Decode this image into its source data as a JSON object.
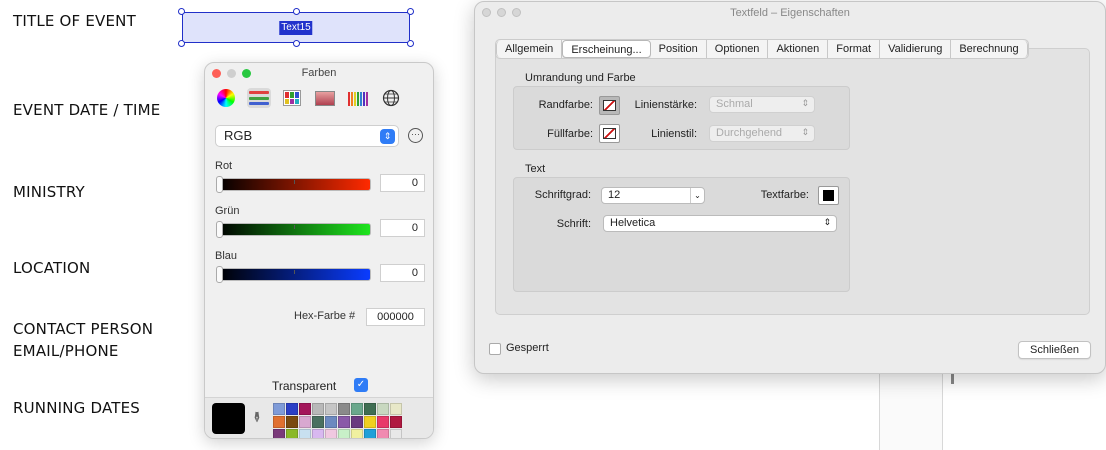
{
  "document": {
    "labels": [
      "TITLE OF EVENT",
      "EVENT DATE / TIME",
      "MINISTRY",
      "LOCATION",
      "CONTACT PERSON",
      "EMAIL/PHONE",
      "RUNNING DATES"
    ],
    "field_name": "Text15"
  },
  "colors_panel": {
    "title": "Farben",
    "mode_icons": [
      "color-wheel-icon",
      "sliders-icon",
      "palettes-icon",
      "image-palette-icon",
      "pencils-icon",
      "web-icon"
    ],
    "model": "RGB",
    "channels": [
      {
        "label": "Rot",
        "value": "0",
        "gradient_end": "#ff2a00"
      },
      {
        "label": "Grün",
        "value": "0",
        "gradient_end": "#1ee51e"
      },
      {
        "label": "Blau",
        "value": "0",
        "gradient_end": "#0a3cff"
      }
    ],
    "hex_label": "Hex-Farbe #",
    "hex_value": "000000",
    "transparent_label": "Transparent",
    "transparent_checked": true,
    "current_color": "#000000",
    "swatches": [
      "#7f9bd8",
      "#2b3fc6",
      "#a3165a",
      "#b8b8b8",
      "#c5c5c5",
      "#8a8a8a",
      "#6aa88c",
      "#3f6e52",
      "#c8d8c0",
      "#e8e8c8",
      "#e07030",
      "#7a4a10",
      "#d8a8d0",
      "#4a7060",
      "#6c8ac0",
      "#8a5aa8",
      "#6a3a80",
      "#f0d020",
      "#e83a6a",
      "#b01840",
      "#7a3a7a",
      "#8ab828",
      "#c8e0f0",
      "#d8b8f0",
      "#f0c8e0",
      "#c8f0c8",
      "#f0f0a0",
      "#20a0d8",
      "#f08ab0",
      "#e8e8e8"
    ]
  },
  "properties_window": {
    "title": "Textfeld – Eigenschaften",
    "tabs": [
      "Allgemein",
      "Erscheinung...",
      "Position",
      "Optionen",
      "Aktionen",
      "Format",
      "Validierung",
      "Berechnung"
    ],
    "active_tab": "Erscheinung...",
    "border_section": {
      "title": "Umrandung und Farbe",
      "border_color_label": "Randfarbe:",
      "line_width_label": "Linienstärke:",
      "line_width_value": "Schmal",
      "fill_color_label": "Füllfarbe:",
      "line_style_label": "Linienstil:",
      "line_style_value": "Durchgehend"
    },
    "text_section": {
      "title": "Text",
      "font_size_label": "Schriftgrad:",
      "font_size_value": "12",
      "text_color_label": "Textfarbe:",
      "text_color": "#000000",
      "font_label": "Schrift:",
      "font_value": "Helvetica"
    },
    "locked_label": "Gesperrt",
    "locked_checked": false,
    "close_label": "Schließen"
  }
}
